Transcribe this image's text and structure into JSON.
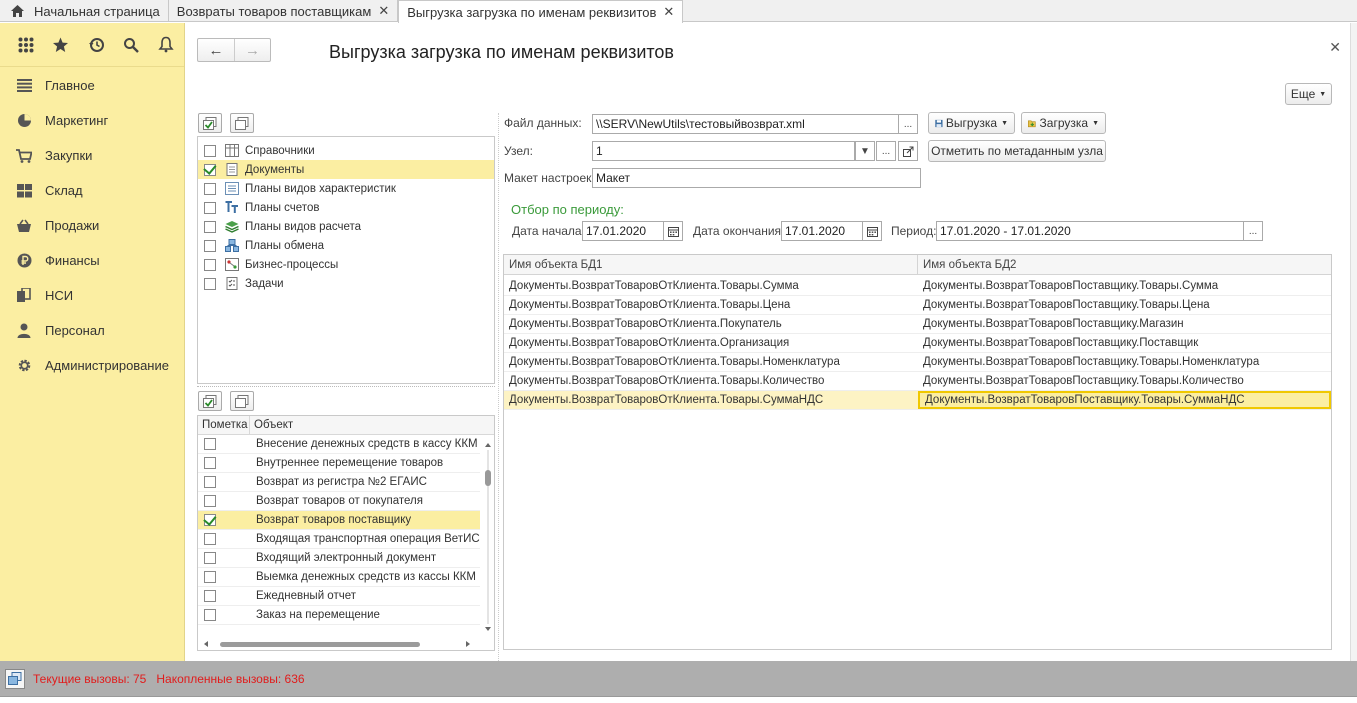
{
  "tabs": {
    "home_label": "Начальная страница",
    "tab1_label": "Возвраты товаров поставщикам",
    "tab2_label": "Выгрузка загрузка по именам реквизитов",
    "close_glyph": "✕"
  },
  "sidebar": {
    "items": [
      {
        "label": "Главное",
        "icon": "menu-lines-icon"
      },
      {
        "label": "Маркетинг",
        "icon": "pie-chart-icon"
      },
      {
        "label": "Закупки",
        "icon": "cart-icon"
      },
      {
        "label": "Склад",
        "icon": "warehouse-grid-icon"
      },
      {
        "label": "Продажи",
        "icon": "basket-icon"
      },
      {
        "label": "Финансы",
        "icon": "ruble-icon"
      },
      {
        "label": "НСИ",
        "icon": "books-icon"
      },
      {
        "label": "Персонал",
        "icon": "person-icon"
      },
      {
        "label": "Администрирование",
        "icon": "gear-icon"
      }
    ]
  },
  "header": {
    "title": "Выгрузка загрузка по именам реквизитов",
    "more_label": "Еще"
  },
  "tree": {
    "items": [
      {
        "label": "Справочники",
        "checked": false
      },
      {
        "label": "Документы",
        "checked": true
      },
      {
        "label": "Планы видов характеристик",
        "checked": false
      },
      {
        "label": "Планы счетов",
        "checked": false
      },
      {
        "label": "Планы видов расчета",
        "checked": false
      },
      {
        "label": "Планы обмена",
        "checked": false
      },
      {
        "label": "Бизнес-процессы",
        "checked": false
      },
      {
        "label": "Задачи",
        "checked": false
      }
    ]
  },
  "objects": {
    "col_mark": "Пометка",
    "col_object": "Объект",
    "rows": [
      {
        "label": "Внесение денежных средств в кассу ККМ",
        "checked": false
      },
      {
        "label": "Внутреннее перемещение товаров",
        "checked": false
      },
      {
        "label": "Возврат из регистра №2 ЕГАИС",
        "checked": false
      },
      {
        "label": "Возврат товаров от покупателя",
        "checked": false
      },
      {
        "label": "Возврат товаров поставщику",
        "checked": true
      },
      {
        "label": "Входящая транспортная операция ВетИС",
        "checked": false
      },
      {
        "label": "Входящий электронный документ",
        "checked": false
      },
      {
        "label": "Выемка денежных средств из кассы ККМ",
        "checked": false
      },
      {
        "label": "Ежедневный отчет",
        "checked": false
      },
      {
        "label": "Заказ на перемещение",
        "checked": false
      }
    ]
  },
  "form": {
    "file_label": "Файл данных:",
    "file_value": "\\\\SERV\\NewUtils\\тестовыйвозврат.xml",
    "upload_label": "Выгрузка",
    "download_label": "Загрузка",
    "node_label": "Узел:",
    "node_value": "1",
    "mark_meta_label": "Отметить по метаданным узла",
    "template_label": "Макет настроек:",
    "template_value": "Макет",
    "period_group": "Отбор по периоду:",
    "start_label": "Дата начала:",
    "start_value": "17.01.2020",
    "end_label": "Дата окончания:",
    "end_value": "17.01.2020",
    "period_label": "Период:",
    "period_value": "17.01.2020 - 17.01.2020",
    "ellipsis": "..."
  },
  "grid": {
    "col1": "Имя объекта БД1",
    "col2": "Имя объекта БД2",
    "rows": [
      {
        "a": "Документы.ВозвратТоваровОтКлиента.Товары.Сумма",
        "b": "Документы.ВозвратТоваровПоставщику.Товары.Сумма"
      },
      {
        "a": "Документы.ВозвратТоваровОтКлиента.Товары.Цена",
        "b": "Документы.ВозвратТоваровПоставщику.Товары.Цена"
      },
      {
        "a": "Документы.ВозвратТоваровОтКлиента.Покупатель",
        "b": "Документы.ВозвратТоваровПоставщику.Магазин"
      },
      {
        "a": "Документы.ВозвратТоваровОтКлиента.Организация",
        "b": "Документы.ВозвратТоваровПоставщику.Поставщик"
      },
      {
        "a": "Документы.ВозвратТоваровОтКлиента.Товары.Номенклатура",
        "b": "Документы.ВозвратТоваровПоставщику.Товары.Номенклатура"
      },
      {
        "a": "Документы.ВозвратТоваровОтКлиента.Товары.Количество",
        "b": "Документы.ВозвратТоваровПоставщику.Товары.Количество"
      },
      {
        "a": "Документы.ВозвратТоваровОтКлиента.Товары.СуммаНДС",
        "b": "Документы.ВозвратТоваровПоставщику.Товары.СуммаНДС"
      }
    ]
  },
  "status": {
    "text": "Текущие вызовы: 75   Накопленные вызовы: 636",
    "color": "#e11c1c"
  },
  "colors": {
    "accent": "#fbeea2",
    "check": "#2a8a2a",
    "group_title": "#3a9a3a"
  }
}
